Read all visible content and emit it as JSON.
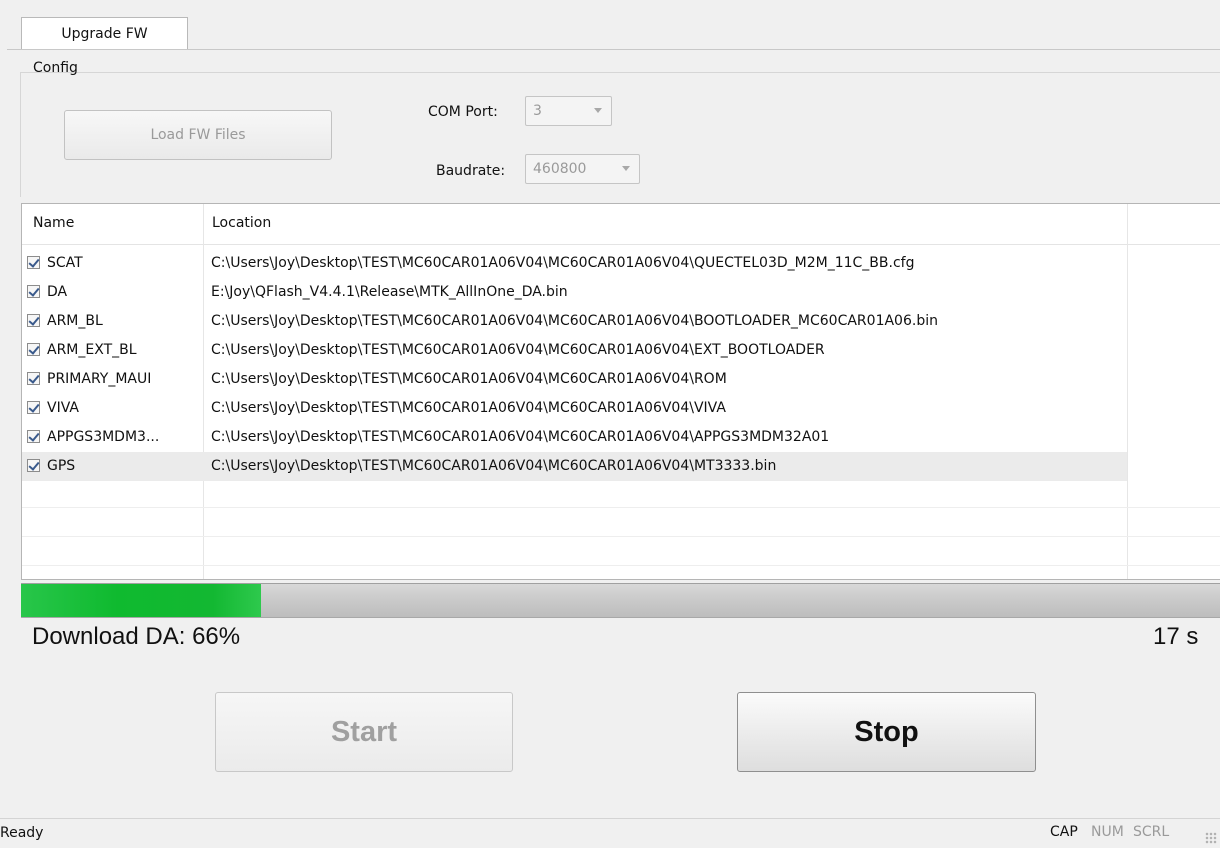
{
  "tab": {
    "label": "Upgrade FW"
  },
  "config": {
    "group_label": "Config",
    "load_button": "Load FW Files",
    "com_port_label": "COM Port:",
    "com_port_value": "3",
    "baudrate_label": "Baudrate:",
    "baudrate_value": "460800"
  },
  "file_list": {
    "columns": [
      "Name",
      "Location"
    ],
    "rows": [
      {
        "name": "SCAT",
        "checked": true,
        "location": "C:\\Users\\Joy\\Desktop\\TEST\\MC60CAR01A06V04\\MC60CAR01A06V04\\QUECTEL03D_M2M_11C_BB.cfg"
      },
      {
        "name": "DA",
        "checked": true,
        "location": "E:\\Joy\\QFlash_V4.4.1\\Release\\MTK_AllInOne_DA.bin"
      },
      {
        "name": "ARM_BL",
        "checked": true,
        "location": "C:\\Users\\Joy\\Desktop\\TEST\\MC60CAR01A06V04\\MC60CAR01A06V04\\BOOTLOADER_MC60CAR01A06.bin"
      },
      {
        "name": "ARM_EXT_BL",
        "checked": true,
        "location": "C:\\Users\\Joy\\Desktop\\TEST\\MC60CAR01A06V04\\MC60CAR01A06V04\\EXT_BOOTLOADER"
      },
      {
        "name": "PRIMARY_MAUI",
        "checked": true,
        "location": "C:\\Users\\Joy\\Desktop\\TEST\\MC60CAR01A06V04\\MC60CAR01A06V04\\ROM"
      },
      {
        "name": "VIVA",
        "checked": true,
        "location": "C:\\Users\\Joy\\Desktop\\TEST\\MC60CAR01A06V04\\MC60CAR01A06V04\\VIVA"
      },
      {
        "name": "APPGS3MDM3...",
        "checked": true,
        "location": "C:\\Users\\Joy\\Desktop\\TEST\\MC60CAR01A06V04\\MC60CAR01A06V04\\APPGS3MDM32A01"
      },
      {
        "name": "GPS",
        "checked": true,
        "location": "C:\\Users\\Joy\\Desktop\\TEST\\MC60CAR01A06V04\\MC60CAR01A06V04\\MT3333.bin"
      }
    ]
  },
  "progress": {
    "fraction": 0.2,
    "status_text": "Download DA: 66%",
    "elapsed_text": "17 s"
  },
  "buttons": {
    "start": "Start",
    "stop": "Stop"
  },
  "statusbar": {
    "ready": "Ready",
    "cap": "CAP",
    "num": "NUM",
    "scrl": "SCRL"
  },
  "colors": {
    "progress_fill": "#13b832",
    "disabled_text": "#9a9a9a"
  }
}
